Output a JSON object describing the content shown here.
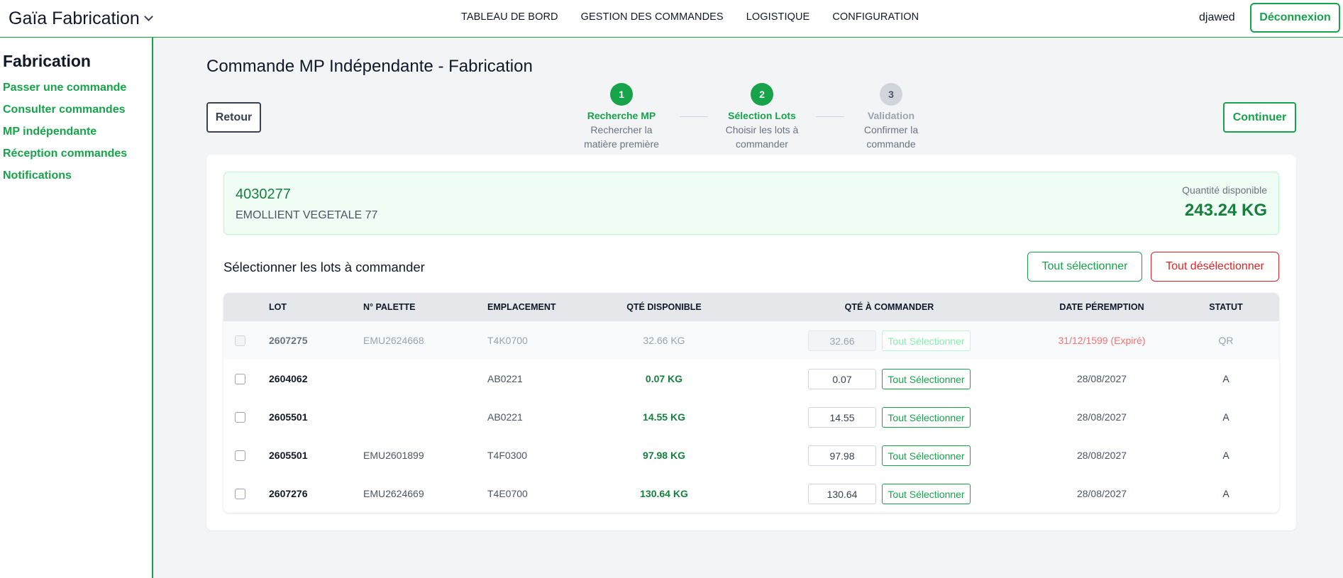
{
  "app": {
    "brand": "Gaïa Fabrication"
  },
  "nav": [
    "TABLEAU DE BORD",
    "GESTION DES COMMANDES",
    "LOGISTIQUE",
    "CONFIGURATION"
  ],
  "user": {
    "name": "djawed",
    "logout_label": "Déconnexion"
  },
  "sidebar": {
    "title": "Fabrication",
    "items": [
      "Passer une commande",
      "Consulter commandes",
      "MP indépendante",
      "Réception commandes",
      "Notifications"
    ]
  },
  "page": {
    "title": "Commande MP Indépendante - Fabrication",
    "back_label": "Retour",
    "continue_label": "Continuer"
  },
  "steps": [
    {
      "number": "1",
      "title": "Recherche MP",
      "desc": "Rechercher la matière première",
      "state": "done"
    },
    {
      "number": "2",
      "title": "Sélection Lots",
      "desc": "Choisir les lots à commander",
      "state": "done"
    },
    {
      "number": "3",
      "title": "Validation",
      "desc": "Confirmer la commande",
      "state": "todo"
    }
  ],
  "material": {
    "code": "4030277",
    "name": "EMOLLIENT VEGETALE 77",
    "qty_label": "Quantité disponible",
    "qty_value": "243.24 KG"
  },
  "selection": {
    "title": "Sélectionner les lots à commander",
    "select_all_label": "Tout sélectionner",
    "deselect_all_label": "Tout désélectionner"
  },
  "table": {
    "headers": {
      "lot": "LOT",
      "palette": "N° PALETTE",
      "emplacement": "EMPLACEMENT",
      "qty_dispo": "QTÉ DISPONIBLE",
      "qty_cmd": "QTÉ À COMMANDER",
      "date": "DATE PÉREMPTION",
      "statut": "STATUT"
    },
    "row_button_label": "Tout Sélectionner",
    "rows": [
      {
        "lot": "2607275",
        "palette": "EMU2624668",
        "emplacement": "T4K0700",
        "qty_dispo": "32.66 KG",
        "qty_cmd": "32.66",
        "date": "31/12/1599 (Expiré)",
        "statut": "QR",
        "expired": true
      },
      {
        "lot": "2604062",
        "palette": "",
        "emplacement": "AB0221",
        "qty_dispo": "0.07 KG",
        "qty_cmd": "0.07",
        "date": "28/08/2027",
        "statut": "A",
        "expired": false
      },
      {
        "lot": "2605501",
        "palette": "",
        "emplacement": "AB0221",
        "qty_dispo": "14.55 KG",
        "qty_cmd": "14.55",
        "date": "28/08/2027",
        "statut": "A",
        "expired": false
      },
      {
        "lot": "2605501",
        "palette": "EMU2601899",
        "emplacement": "T4F0300",
        "qty_dispo": "97.98 KG",
        "qty_cmd": "97.98",
        "date": "28/08/2027",
        "statut": "A",
        "expired": false
      },
      {
        "lot": "2607276",
        "palette": "EMU2624669",
        "emplacement": "T4E0700",
        "qty_dispo": "130.64 KG",
        "qty_cmd": "130.64",
        "date": "28/08/2027",
        "statut": "A",
        "expired": false
      }
    ]
  },
  "colors": {
    "accent": "#16a34a",
    "danger": "#dc2626",
    "expired_text": "#f87171"
  },
  "icons": {
    "brand_dropdown": "chevron-down-icon"
  }
}
